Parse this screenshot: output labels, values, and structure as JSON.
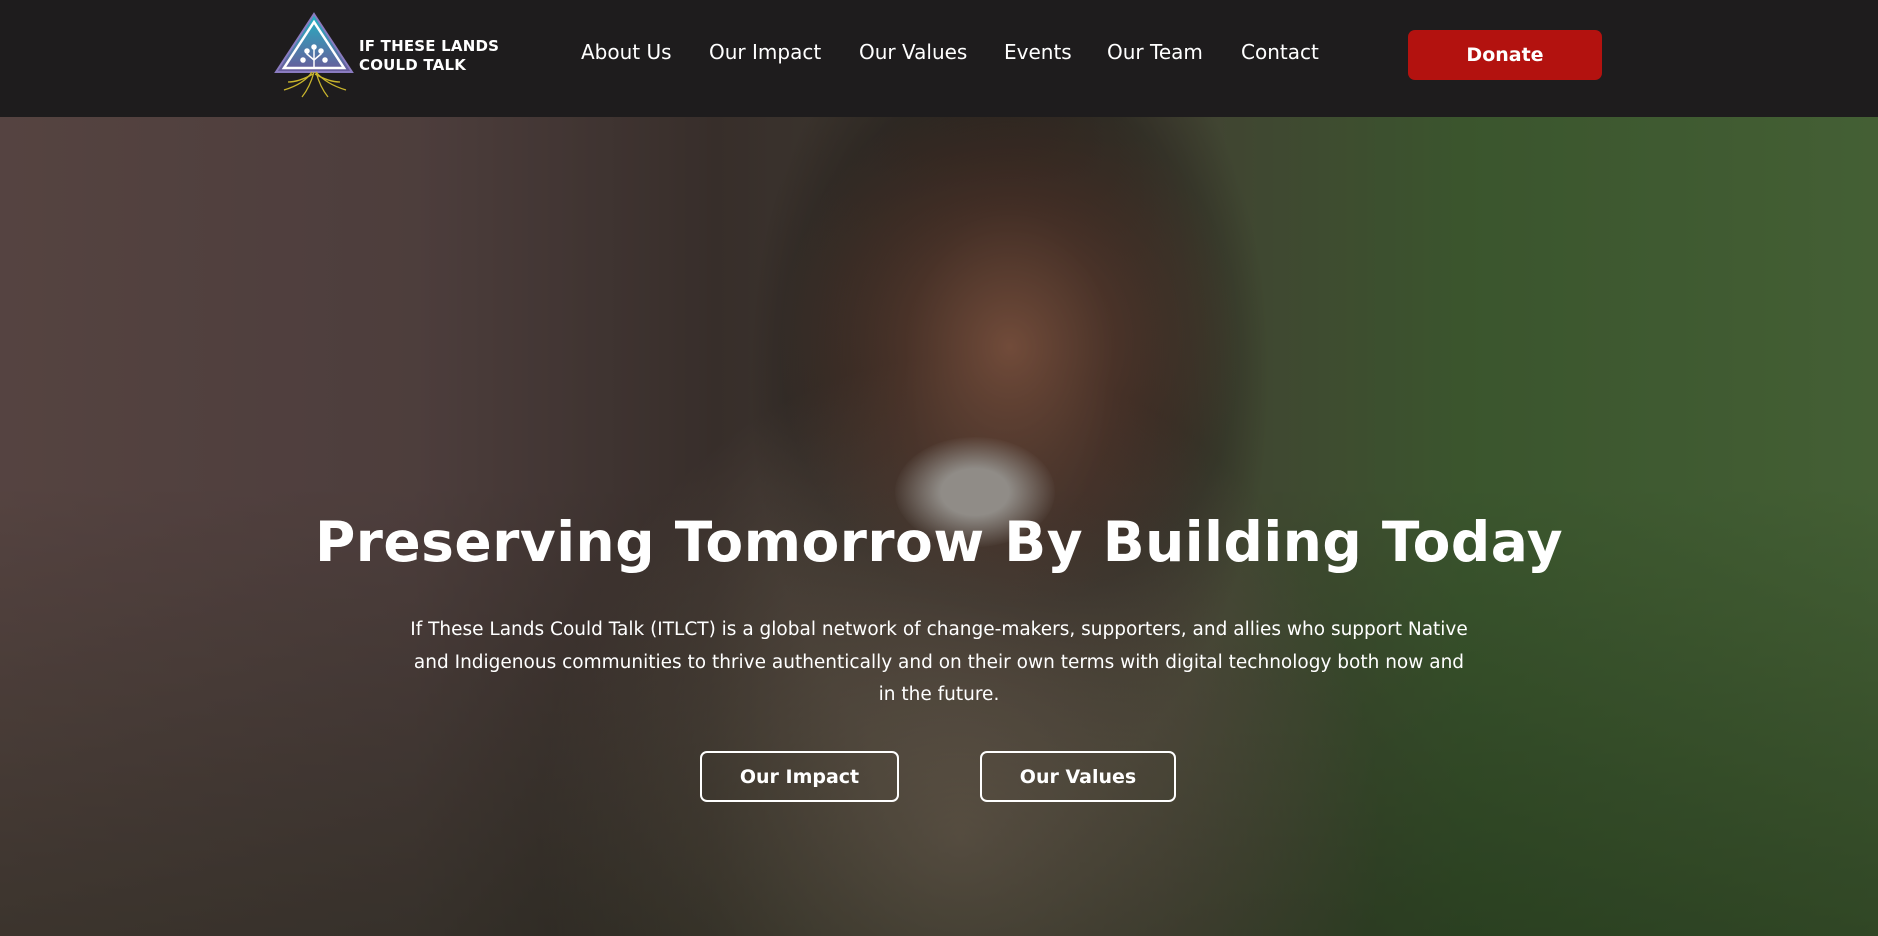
{
  "brand": {
    "name_line1": "IF THESE LANDS",
    "name_line2": "COULD TALK"
  },
  "nav": {
    "items": [
      {
        "label": "About Us"
      },
      {
        "label": "Our Impact"
      },
      {
        "label": "Our Values"
      },
      {
        "label": "Events"
      },
      {
        "label": "Our Team"
      },
      {
        "label": "Contact"
      }
    ],
    "donate_label": "Donate"
  },
  "hero": {
    "title": "Preserving Tomorrow By Building Today",
    "description": "If These Lands Could Talk (ITLCT) is a global network of change-makers, supporters, and allies who support Native and Indigenous communities to thrive authentically and on their own terms with digital technology both now and in the future.",
    "buttons": [
      {
        "label": "Our Impact"
      },
      {
        "label": "Our Values"
      }
    ]
  },
  "colors": {
    "nav_bg": "#1e1c1d",
    "donate": "#b3120f"
  }
}
